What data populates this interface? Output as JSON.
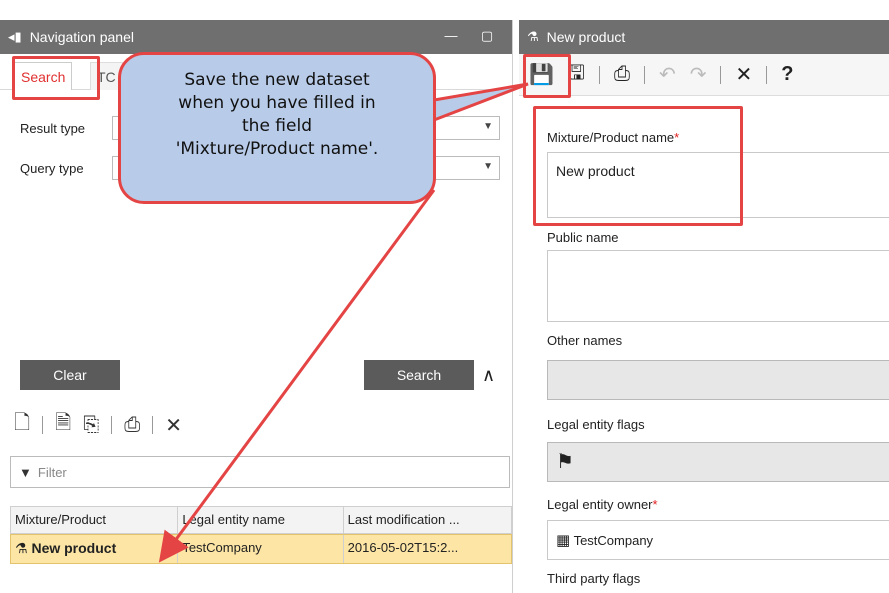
{
  "nav": {
    "title": "Navigation panel",
    "tabs": [
      {
        "label": "Search"
      },
      {
        "label": "TC"
      }
    ],
    "result_type_label": "Result type",
    "query_type_label": "Query type",
    "clear_label": "Clear",
    "search_label": "Search",
    "filter_placeholder": "Filter",
    "grid": {
      "columns": [
        "Mixture/Product",
        "Legal entity name",
        "Last modification ..."
      ],
      "rows": [
        {
          "product": "New product",
          "entity": "TestCompany",
          "modified": "2016-05-02T15:2..."
        }
      ]
    }
  },
  "detail": {
    "title": "New product",
    "fields": {
      "name_label": "Mixture/Product name",
      "name_value": "New product",
      "public_name_label": "Public name",
      "other_names_label": "Other names",
      "flags_label": "Legal entity flags",
      "owner_label": "Legal entity owner",
      "owner_value": "TestCompany",
      "third_party_label": "Third party flags"
    },
    "required_marker": "*"
  },
  "callout": {
    "lines": [
      "Save the new dataset",
      "when you have filled in",
      "the field",
      "'Mixture/Product name'."
    ]
  },
  "colors": {
    "accent": "#e44444",
    "header_bg": "#6f6f6f",
    "callout_bg": "#b8cbe8",
    "selected_row": "#fce5a5"
  }
}
